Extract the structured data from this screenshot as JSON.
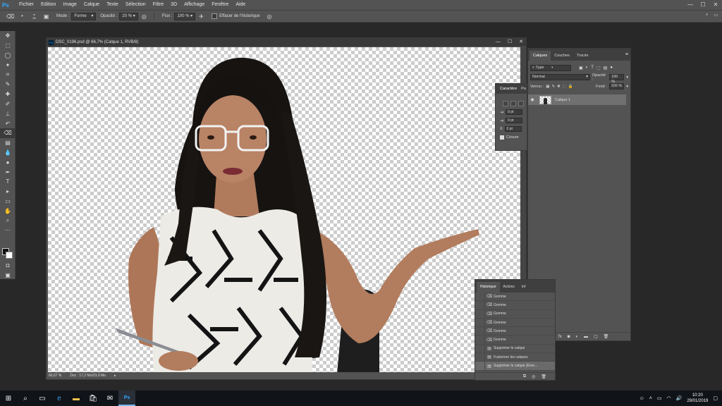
{
  "app": {
    "logo": "Ps"
  },
  "menu": [
    "Fichier",
    "Edition",
    "Image",
    "Calque",
    "Texte",
    "Sélection",
    "Filtre",
    "3D",
    "Affichage",
    "Fenêtre",
    "Aide"
  ],
  "window_controls": {
    "minimize": "—",
    "maximize": "☐",
    "close": "✕"
  },
  "options": {
    "brush_size": "38",
    "mode_label": "Mode :",
    "mode_value": "Forme",
    "opacity_label": "Opacité :",
    "opacity_value": "20 %",
    "flux_label": "Flux :",
    "flux_value": "100 %",
    "erase_history_label": "Effacer de l'historique"
  },
  "document": {
    "title": "DSC_0196.psd @ 66,7% (Calque 1, RVB/8)",
    "zoom": "66,67 %",
    "doc_info": "Doc : 17,2 Mo/23,9 Mo"
  },
  "character_panel": {
    "tabs": [
      "Caractère",
      "Pa"
    ],
    "fields": [
      "0 pt",
      "0 pt",
      "0 pt"
    ],
    "hyphenation_label": "Césure"
  },
  "layers_panel": {
    "tabs": [
      "Calques",
      "Couches",
      "Tracés"
    ],
    "filter_value": "Type",
    "blend_mode": "Normal",
    "opacity_label": "Opacité :",
    "opacity_value": "100 %",
    "lock_label": "Verrou :",
    "fill_label": "Fond :",
    "fill_value": "100 %",
    "layer_name": "Calque 1"
  },
  "history_panel": {
    "tabs": [
      "Historique",
      "Actions",
      "Inf"
    ],
    "items": [
      {
        "label": "Gomme",
        "icon": "eraser-icon"
      },
      {
        "label": "Gomme",
        "icon": "eraser-icon"
      },
      {
        "label": "Gomme",
        "icon": "eraser-icon"
      },
      {
        "label": "Gomme",
        "icon": "eraser-icon"
      },
      {
        "label": "Gomme",
        "icon": "eraser-icon"
      },
      {
        "label": "Gomme",
        "icon": "eraser-icon"
      },
      {
        "label": "Supprimer le calque",
        "icon": "layer-icon"
      },
      {
        "label": "Fusionner les calques",
        "icon": "layer-icon"
      },
      {
        "label": "Supprimer le calque (Enre...",
        "icon": "layer-icon",
        "active": true
      }
    ]
  },
  "taskbar": {
    "time": "10:20",
    "date": "29/01/2019"
  }
}
